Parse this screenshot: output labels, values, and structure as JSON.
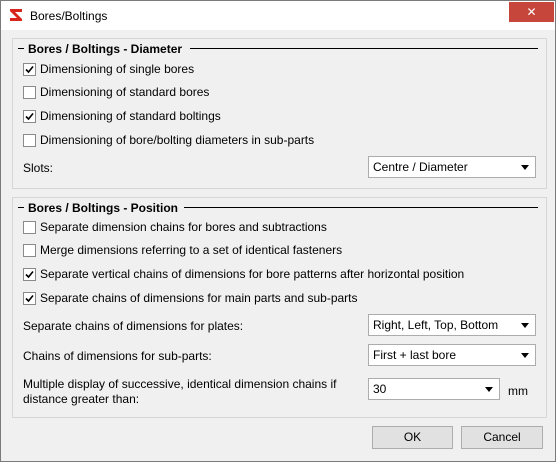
{
  "window": {
    "title": "Bores/Boltings",
    "close_glyph": "✕",
    "app_icon": "hicad-logo-icon"
  },
  "diameter_group": {
    "title": "Bores / Boltings - Diameter",
    "options": [
      {
        "label": "Dimensioning of single bores",
        "checked": true
      },
      {
        "label": "Dimensioning of standard bores",
        "checked": false
      },
      {
        "label": "Dimensioning of standard boltings",
        "checked": true
      },
      {
        "label": "Dimensioning of bore/bolting diameters in sub-parts",
        "checked": false
      }
    ],
    "slots_label": "Slots:",
    "slots_value": "Centre / Diameter"
  },
  "position_group": {
    "title": "Bores / Boltings - Position",
    "options": [
      {
        "label": "Separate dimension chains for bores and subtractions",
        "checked": false
      },
      {
        "label": "Merge dimensions referring to a set of identical fasteners",
        "checked": false
      },
      {
        "label": "Separate vertical chains of dimensions for bore patterns after horizontal position",
        "checked": true
      },
      {
        "label": "Separate chains of dimensions for main parts and sub-parts",
        "checked": true
      }
    ],
    "plates_label": "Separate chains of dimensions for plates:",
    "plates_value": "Right, Left, Top, Bottom",
    "subparts_label": "Chains of dimensions for sub-parts:",
    "subparts_value": "First + last bore",
    "multiple_label_line1": "Multiple display of successive, identical dimension chains if",
    "multiple_label_line2": "distance greater than:",
    "multiple_value": "30",
    "multiple_unit": "mm"
  },
  "buttons": {
    "ok": "OK",
    "cancel": "Cancel"
  }
}
